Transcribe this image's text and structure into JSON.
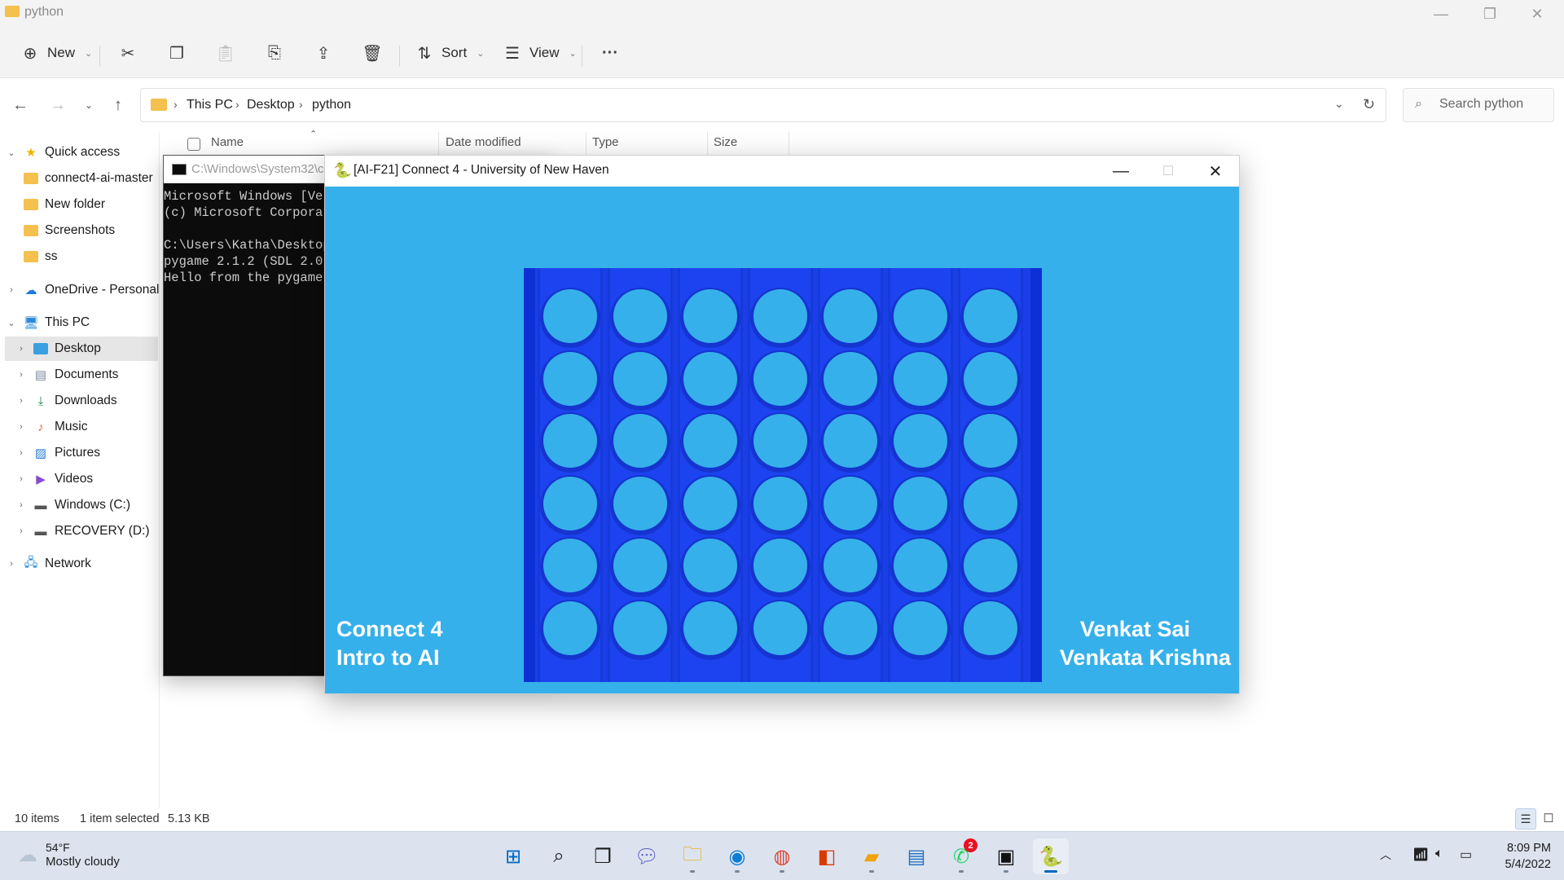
{
  "explorer": {
    "title": "python",
    "window_controls": {
      "minimize": "—",
      "restore": "❐",
      "close": "✕"
    },
    "commands": {
      "new_label": "New",
      "sort_label": "Sort",
      "view_label": "View",
      "more_label": "···"
    },
    "breadcrumb": [
      "This PC",
      "Desktop",
      "python"
    ],
    "search_placeholder": "Search python",
    "columns": [
      "Name",
      "Date modified",
      "Type",
      "Size"
    ],
    "sidebar": {
      "quick_access": "Quick access",
      "quick_items": [
        "connect4-ai-master",
        "New folder",
        "Screenshots",
        "ss"
      ],
      "onedrive": "OneDrive - Personal",
      "this_pc": "This PC",
      "pc_items": [
        "Desktop",
        "Documents",
        "Downloads",
        "Music",
        "Pictures",
        "Videos",
        "Windows (C:)",
        "RECOVERY (D:)"
      ],
      "network": "Network"
    },
    "status": {
      "count": "10 items",
      "selected": "1 item selected",
      "size": "5.13 KB"
    }
  },
  "console": {
    "title": "C:\\Windows\\System32\\c",
    "lines": [
      "Microsoft Windows [Ver",
      "(c) Microsoft Corporat",
      "",
      "C:\\Users\\Katha\\Desktop",
      "pygame 2.1.2 (SDL 2.0.",
      "Hello from the pygame "
    ]
  },
  "game": {
    "title": "[AI-F21] Connect 4 - University of New Haven",
    "left_text": [
      "Connect 4",
      "Intro to AI"
    ],
    "right_text": [
      "Venkat Sai",
      "Venkata Krishna"
    ],
    "board": {
      "rows": 6,
      "columns": 7,
      "board_color": "#1a3ee8",
      "empty_color": "#36b0ea"
    }
  },
  "taskbar": {
    "weather_temp": "54°F",
    "weather_desc": "Mostly cloudy",
    "whatsapp_badge": "2",
    "time": "8:09 PM",
    "date": "5/4/2022"
  }
}
